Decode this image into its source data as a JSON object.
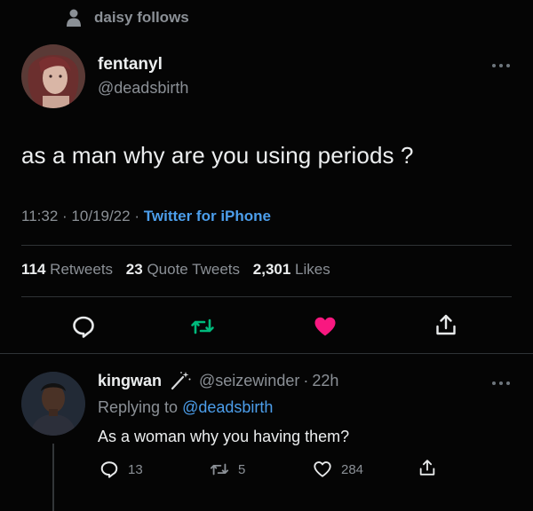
{
  "social_context": {
    "icon": "person-icon",
    "text": "daisy follows"
  },
  "tweet": {
    "author_name": "fentanyl",
    "author_handle": "@deadsbirth",
    "text": "as a man why are you using periods ?",
    "time": "11:32",
    "date": "10/19/22",
    "source": "Twitter for iPhone",
    "separator": "·",
    "stats": {
      "retweets_count": "114",
      "retweets_label": "Retweets",
      "quotes_count": "23",
      "quotes_label": "Quote Tweets",
      "likes_count": "2,301",
      "likes_label": "Likes"
    },
    "like_color": "#f91880",
    "retweet_color": "#00ba7c"
  },
  "reply": {
    "author_name": "kingwan",
    "author_handle": "@seizewinder",
    "time": "22h",
    "separator": "·",
    "replying_to_label": "Replying to",
    "replying_to_handle": "@deadsbirth",
    "text": "As a woman why you having them?",
    "reply_count": "13",
    "retweet_count": "5",
    "like_count": "284"
  },
  "colors": {
    "background": "#050505",
    "link": "#4c9eeb",
    "muted": "#8b9096"
  }
}
